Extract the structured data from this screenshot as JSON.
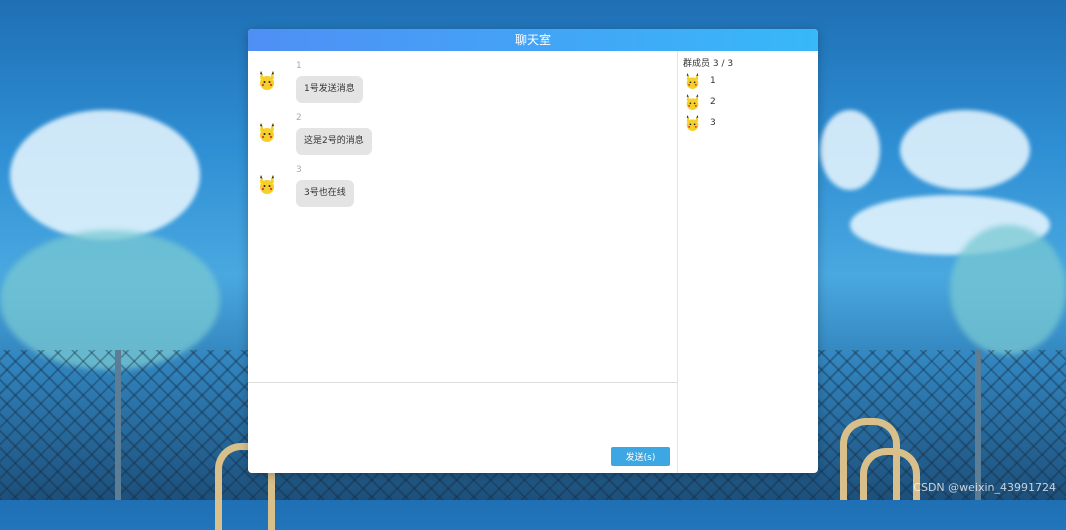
{
  "window": {
    "title": "聊天室"
  },
  "messages": [
    {
      "sender": "1",
      "text": "1号发送消息",
      "avatar_icon": "pikachu-icon"
    },
    {
      "sender": "2",
      "text": "这是2号的消息",
      "avatar_icon": "pikachu-icon"
    },
    {
      "sender": "3",
      "text": "3号也在线",
      "avatar_icon": "pikachu-icon"
    }
  ],
  "composer": {
    "value": "",
    "send_label": "发送(s)"
  },
  "members": {
    "header": "群成员 3 / 3",
    "list": [
      {
        "name": "1",
        "avatar_icon": "pikachu-icon"
      },
      {
        "name": "2",
        "avatar_icon": "pikachu-icon"
      },
      {
        "name": "3",
        "avatar_icon": "pikachu-icon"
      }
    ]
  },
  "watermark": "CSDN @weixin_43991724",
  "colors": {
    "title_gradient_start": "#4f8ff5",
    "title_gradient_end": "#38b8f8",
    "send_button": "#3ca7e2",
    "bubble": "#e4e4e4"
  }
}
